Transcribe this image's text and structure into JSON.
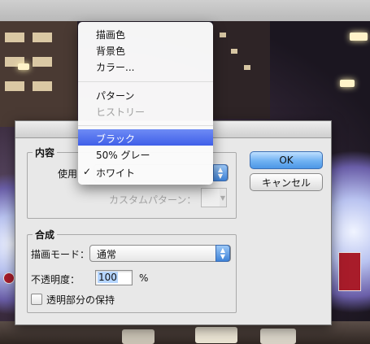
{
  "menu": {
    "items": [
      {
        "label": "描画色",
        "enabled": true
      },
      {
        "label": "背景色",
        "enabled": true
      },
      {
        "label": "カラー...",
        "enabled": true
      },
      {
        "label": "パターン",
        "enabled": true
      },
      {
        "label": "ヒストリー",
        "enabled": false
      },
      {
        "label": "ブラック",
        "enabled": true,
        "highlighted": true
      },
      {
        "label": "50% グレー",
        "enabled": true
      },
      {
        "label": "ホワイト",
        "enabled": true,
        "checked": true
      }
    ],
    "check_mark": "✓"
  },
  "contents": {
    "legend": "内容",
    "use_label": "使用：",
    "custom_pattern_label": "カスタムパターン："
  },
  "blending": {
    "legend": "合成",
    "mode_label": "描画モード：",
    "mode_value": "通常",
    "opacity_label": "不透明度：",
    "opacity_value": "100",
    "opacity_unit": "%",
    "preserve_transparency_label": "透明部分の保持",
    "preserve_transparency_checked": false
  },
  "buttons": {
    "ok": "OK",
    "cancel": "キャンセル"
  },
  "colors": {
    "highlight": "#4a68ea",
    "default_button": "#5aa0ea",
    "dialog_bg": "#e8e8e8"
  }
}
